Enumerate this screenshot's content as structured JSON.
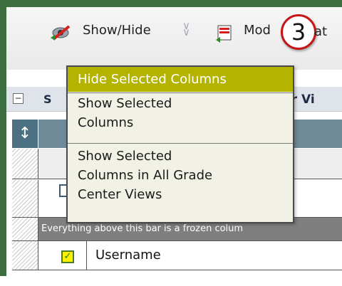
{
  "toolbar": {
    "show_hide_label": "Show/Hide",
    "modify_label": "Mod",
    "step_number": "3",
    "trailing_fragment": "at"
  },
  "grid": {
    "title_left": "S",
    "title_right": "ter Vi",
    "frozen_bar_text": "Everything above this bar is a frozen colum",
    "username_label": "Username"
  },
  "dropdown": {
    "items": [
      {
        "label": "Hide Selected Columns"
      },
      {
        "label": "Show Selected\nColumns"
      },
      {
        "label": "Show Selected\nColumns in All Grade\nCenter Views"
      }
    ]
  },
  "colors": {
    "frame": "#3b6d3f",
    "menu_highlight": "#b4b400",
    "badge_ring": "#c51616"
  }
}
